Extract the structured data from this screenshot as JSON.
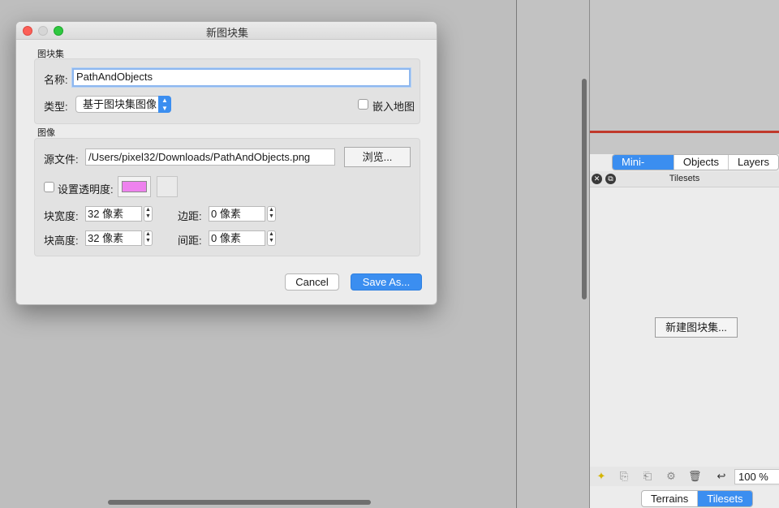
{
  "dialog": {
    "title": "新图块集",
    "section_tileset": "图块集",
    "name_label": "名称:",
    "name_value": "PathAndObjects",
    "type_label": "类型:",
    "type_value": "基于图块集图像",
    "embed_label": "嵌入地图",
    "section_image": "图像",
    "source_label": "源文件:",
    "source_value": "/Users/pixel32/Downloads/PathAndObjects.png",
    "browse_label": "浏览...",
    "transparency_label": "设置透明度:",
    "transparency_color": "#ee82ee",
    "tile_width_label": "块宽度:",
    "tile_width_value": "32 像素",
    "tile_height_label": "块高度:",
    "tile_height_value": "32 像素",
    "margin_label": "边距:",
    "margin_value": "0 像素",
    "spacing_label": "间距:",
    "spacing_value": "0 像素",
    "cancel_label": "Cancel",
    "save_label": "Save As..."
  },
  "dock": {
    "tabs_top": [
      "Mini-map",
      "Objects",
      "Layers"
    ],
    "active_top": "Mini-map",
    "tilesets_title": "Tilesets",
    "new_tileset_label": "新建图块集...",
    "zoom_value": "100 %",
    "tabs_bottom": [
      "Terrains",
      "Tilesets"
    ],
    "active_bottom": "Tilesets",
    "accent_color": "#3b8ef0",
    "divider_color": "#c0392b"
  }
}
